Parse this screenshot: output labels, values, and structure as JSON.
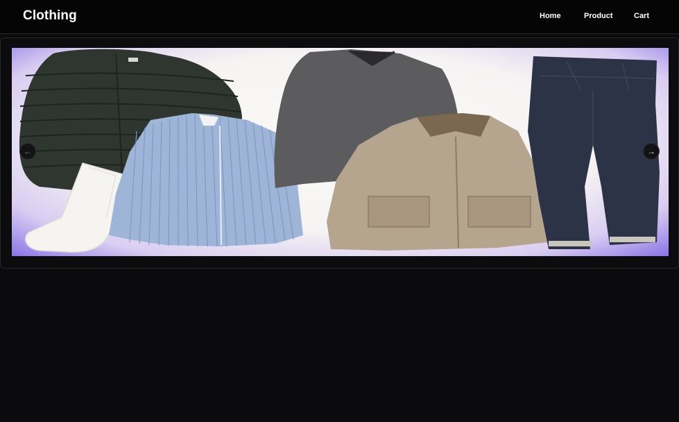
{
  "header": {
    "brand": "Clothing",
    "nav": [
      {
        "label": "Home"
      },
      {
        "label": "Product"
      },
      {
        "label": "Cart"
      }
    ]
  },
  "carousel": {
    "prev_icon": "arrow-left-icon",
    "next_icon": "arrow-right-icon",
    "prev_glyph": "←",
    "next_glyph": "→",
    "slide_items": [
      "puffer-jacket",
      "socks",
      "striped-shirt",
      "sweater",
      "jacket",
      "jeans"
    ]
  },
  "colors": {
    "background": "#0b0b0e",
    "navbar": "#050505",
    "text": "#ffffff",
    "slide_glow": "#8a74e6"
  }
}
